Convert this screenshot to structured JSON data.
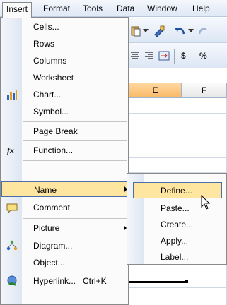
{
  "menubar": {
    "items": [
      "Insert",
      "Format",
      "Tools",
      "Data",
      "Window",
      "Help"
    ]
  },
  "toolbar": {
    "currency_symbol": "$",
    "percent_symbol": "%"
  },
  "sheet": {
    "column_headers": [
      "E",
      "F"
    ],
    "selected_column": "E"
  },
  "insert_menu": {
    "items": [
      {
        "label": "Cells...",
        "icon": null
      },
      {
        "label": "Rows",
        "icon": null
      },
      {
        "label": "Columns",
        "icon": null
      },
      {
        "label": "Worksheet",
        "icon": null
      },
      {
        "label": "Chart...",
        "icon": "chart-icon"
      },
      {
        "label": "Symbol...",
        "icon": null
      },
      {
        "label": "Page Break",
        "icon": null
      },
      {
        "label": "Function...",
        "icon": "function-icon"
      },
      {
        "label": "Name",
        "icon": null,
        "submenu": true,
        "highlighted": true
      },
      {
        "label": "Comment",
        "icon": "comment-icon"
      },
      {
        "label": "Picture",
        "icon": null,
        "submenu": true
      },
      {
        "label": "Diagram...",
        "icon": "diagram-icon"
      },
      {
        "label": "Object...",
        "icon": null
      },
      {
        "label": "Hyperlink...",
        "icon": "hyperlink-icon",
        "shortcut": "Ctrl+K"
      }
    ]
  },
  "name_submenu": {
    "items": [
      {
        "label": "Define...",
        "highlighted": true
      },
      {
        "label": "Paste..."
      },
      {
        "label": "Create..."
      },
      {
        "label": "Apply..."
      },
      {
        "label": "Label..."
      }
    ]
  },
  "colors": {
    "highlight_fill": "#ffe6a0",
    "highlight_border": "#4b6ea8",
    "selected_column_header": "#f9b966"
  }
}
